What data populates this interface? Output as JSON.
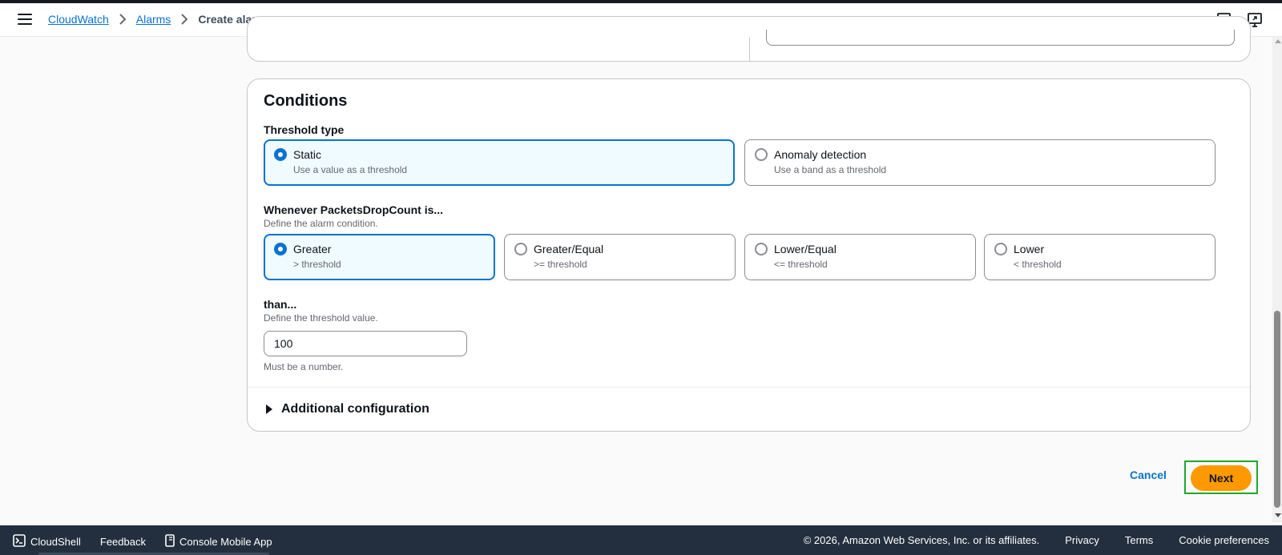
{
  "header": {
    "breadcrumb": {
      "service": "CloudWatch",
      "section": "Alarms",
      "current": "Create alarm"
    },
    "icons": [
      "menu-icon",
      "chevron-right-icon",
      "notifications-icon",
      "screen-share-icon"
    ]
  },
  "conditions": {
    "title": "Conditions",
    "threshold_type": {
      "label": "Threshold type",
      "options": [
        {
          "label": "Static",
          "description": "Use a value as a threshold",
          "selected": true
        },
        {
          "label": "Anomaly detection",
          "description": "Use a band as a threshold",
          "selected": false
        }
      ]
    },
    "whenever": {
      "label": "Whenever PacketsDropCount is...",
      "description": "Define the alarm condition.",
      "options": [
        {
          "label": "Greater",
          "description": "> threshold",
          "selected": true
        },
        {
          "label": "Greater/Equal",
          "description": ">= threshold",
          "selected": false
        },
        {
          "label": "Lower/Equal",
          "description": "<= threshold",
          "selected": false
        },
        {
          "label": "Lower",
          "description": "< threshold",
          "selected": false
        }
      ]
    },
    "than": {
      "label": "than...",
      "description": "Define the threshold value.",
      "value": "100",
      "constraint": "Must be a number."
    },
    "additional": {
      "label": "Additional configuration"
    }
  },
  "actions": {
    "cancel_label": "Cancel",
    "next_label": "Next"
  },
  "footer": {
    "cloudshell": "CloudShell",
    "feedback": "Feedback",
    "mobile_app": "Console Mobile App",
    "copyright": "© 2026, Amazon Web Services, Inc. or its affiliates.",
    "privacy": "Privacy",
    "terms": "Terms",
    "cookies": "Cookie preferences"
  },
  "colors": {
    "accent": "#0972d3",
    "primary_button": "#ff9900",
    "highlight": "#1ea82d",
    "footer_bg": "#232f3e"
  }
}
